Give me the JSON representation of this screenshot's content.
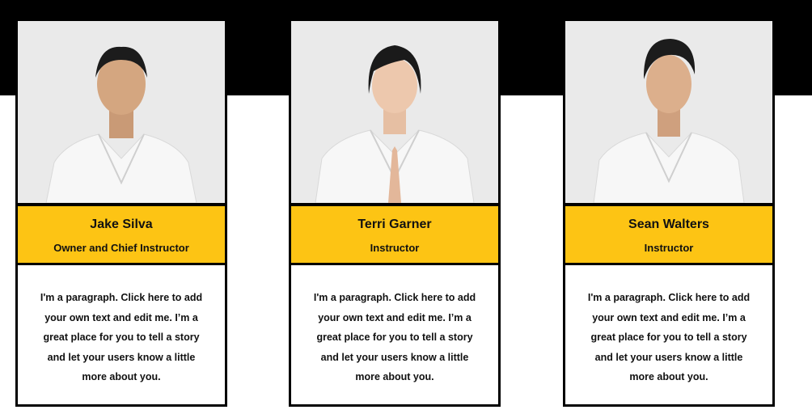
{
  "team": [
    {
      "name": "Jake Silva",
      "role": "Owner and Chief Instructor",
      "bio": "I'm a paragraph. Click here to add your own text and edit me. I’m a great place for you to tell a story and let your users know a little more about you.",
      "photo_icon": "instructor-photo"
    },
    {
      "name": "Terri Garner",
      "role": "Instructor",
      "bio": "I'm a paragraph. Click here to add your own text and edit me. I’m a great place for you to tell a story and let your users know a little more about you.",
      "photo_icon": "instructor-photo"
    },
    {
      "name": "Sean Walters",
      "role": "Instructor",
      "bio": "I'm a paragraph. Click here to add your own text and edit me. I’m a great place for you to tell a story and let your users know a little more about you.",
      "photo_icon": "instructor-photo"
    }
  ],
  "colors": {
    "accent": "#fdc414",
    "band": "#000000",
    "card_border": "#000000",
    "gi": "#f7f7f7"
  }
}
